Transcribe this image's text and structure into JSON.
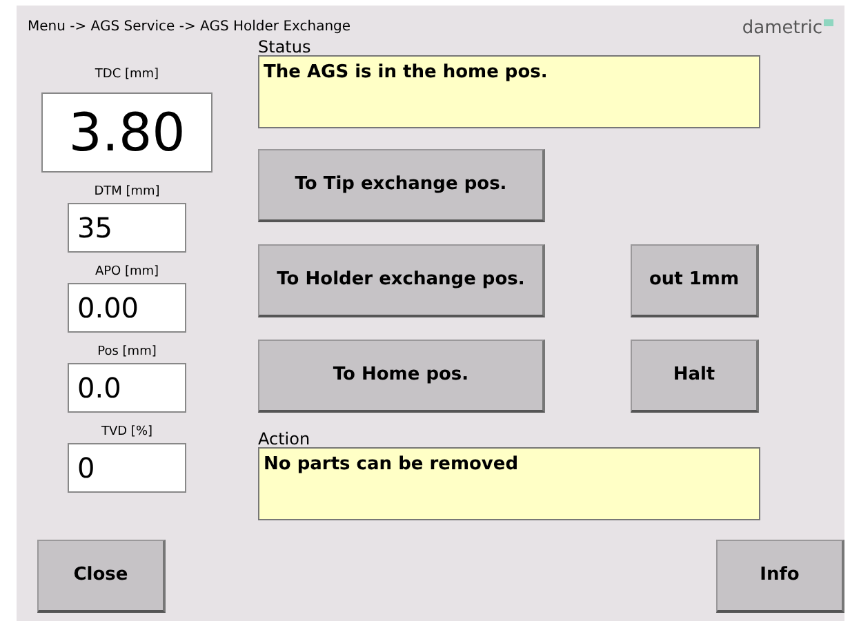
{
  "breadcrumb": "Menu -> AGS Service -> AGS Holder Exchange",
  "logo": "dametric",
  "readouts": [
    {
      "label": "TDC [mm]",
      "value": "3.80",
      "kind": "large"
    },
    {
      "label": "DTM [mm]",
      "value": "35",
      "kind": "small"
    },
    {
      "label": "APO [mm]",
      "value": "0.00",
      "kind": "small"
    },
    {
      "label": "Pos [mm]",
      "value": "0.0",
      "kind": "small"
    },
    {
      "label": "TVD [%]",
      "value": "0",
      "kind": "small"
    }
  ],
  "status": {
    "label": "Status",
    "text": "The AGS is in the home pos."
  },
  "move_buttons": [
    "To Tip exchange pos.",
    "To Holder exchange pos.",
    "To Home pos."
  ],
  "side_buttons": [
    "out 1mm",
    "Halt"
  ],
  "action": {
    "label": "Action",
    "text": "No parts can be removed"
  },
  "footer_buttons": [
    "Close",
    "Info"
  ]
}
